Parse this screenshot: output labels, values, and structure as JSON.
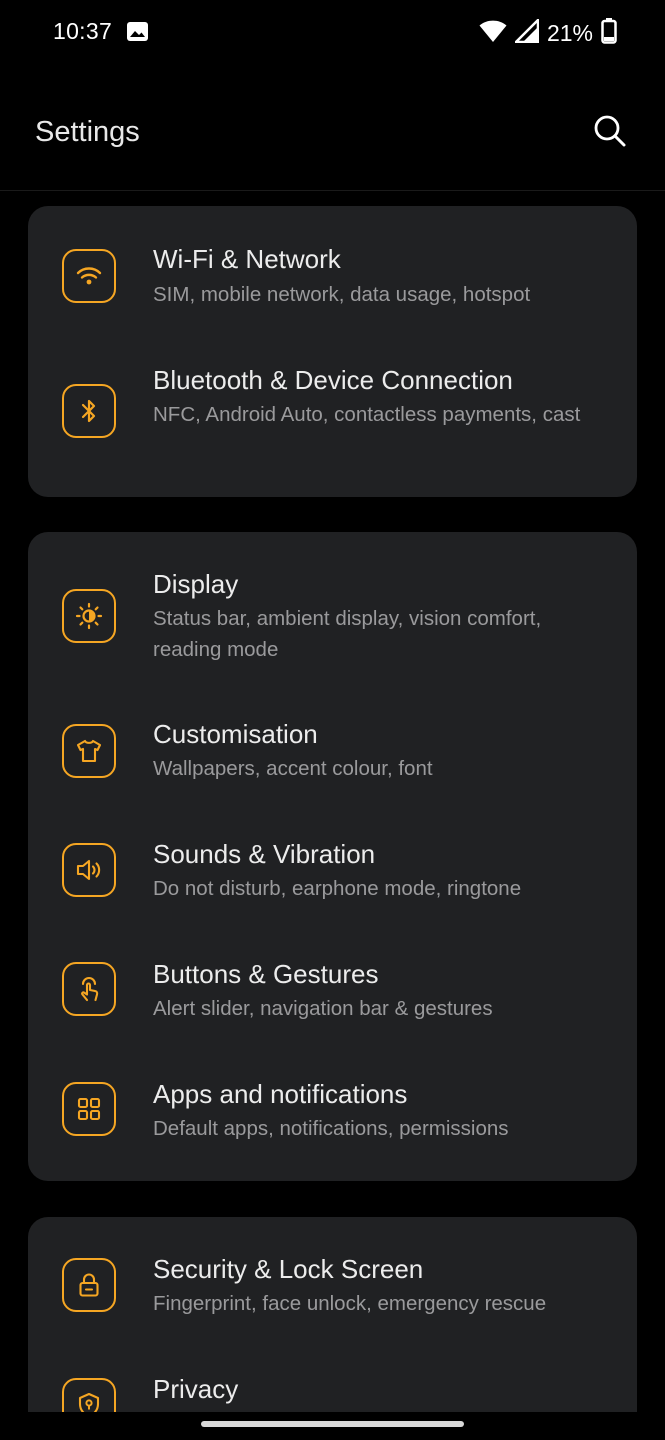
{
  "status_bar": {
    "time": "10:37",
    "battery_percent": "21%",
    "icons": [
      "image-notification-icon",
      "wifi-icon",
      "cell-signal-icon",
      "battery-icon"
    ]
  },
  "header": {
    "title": "Settings",
    "search_icon": "search-icon"
  },
  "accent_color": "#f5a623",
  "sections": [
    {
      "items": [
        {
          "icon": "wifi-icon",
          "title": "Wi-Fi & Network",
          "subtitle": "SIM, mobile network, data usage, hotspot"
        },
        {
          "icon": "bluetooth-icon",
          "title": "Bluetooth & Device Connection",
          "subtitle": "NFC, Android Auto, contactless payments, cast"
        }
      ]
    },
    {
      "items": [
        {
          "icon": "brightness-icon",
          "title": "Display",
          "subtitle": "Status bar, ambient display, vision comfort, reading mode"
        },
        {
          "icon": "tshirt-icon",
          "title": "Customisation",
          "subtitle": "Wallpapers, accent colour, font"
        },
        {
          "icon": "speaker-icon",
          "title": "Sounds & Vibration",
          "subtitle": "Do not disturb, earphone mode, ringtone"
        },
        {
          "icon": "touch-gesture-icon",
          "title": "Buttons & Gestures",
          "subtitle": "Alert slider, navigation bar & gestures"
        },
        {
          "icon": "apps-grid-icon",
          "title": "Apps and notifications",
          "subtitle": "Default apps, notifications, permissions"
        }
      ]
    },
    {
      "items": [
        {
          "icon": "lock-icon",
          "title": "Security & Lock Screen",
          "subtitle": "Fingerprint, face unlock, emergency rescue"
        },
        {
          "icon": "privacy-shield-icon",
          "title": "Privacy",
          "subtitle": ""
        }
      ]
    }
  ]
}
